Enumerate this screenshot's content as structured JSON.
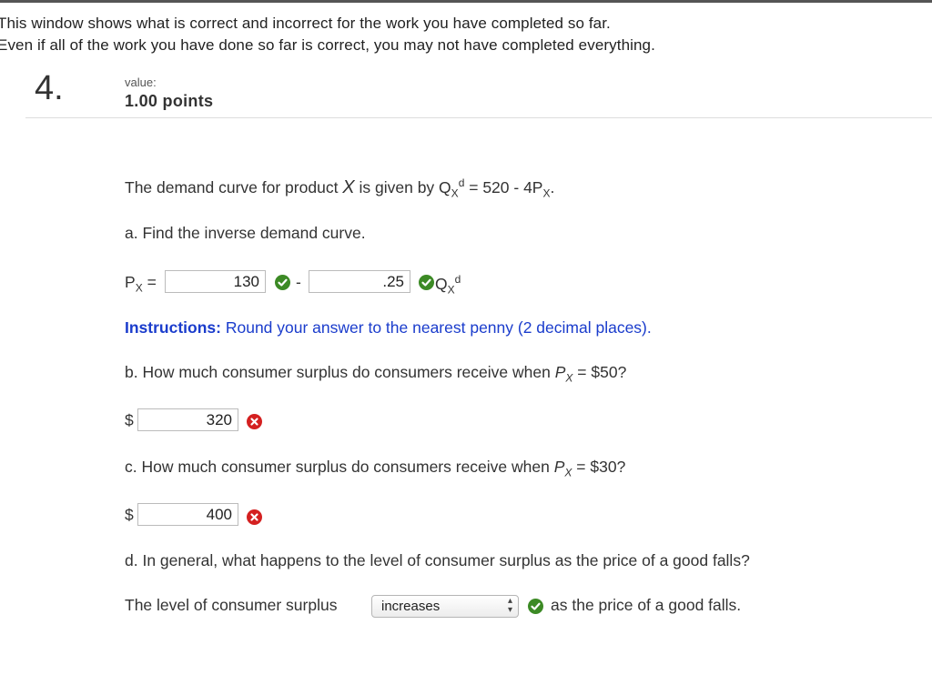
{
  "banner": {
    "line1": "This window shows what is correct and incorrect for the work you have completed so far.",
    "line2": "Even if all of the work you have done so far is correct, you may not have completed everything."
  },
  "question": {
    "number": "4.",
    "value_label": "value:",
    "points": "1.00 points"
  },
  "prompt": {
    "text_before": "The demand curve for product ",
    "var": "X",
    "text_mid": " is given by Q",
    "sub": "X",
    "sup": "d",
    "equation": " = 520 - 4P",
    "sub2": "X",
    "end": "."
  },
  "part_a": {
    "question": "a. Find the inverse demand curve.",
    "lhs": "P",
    "lhs_sub": "X",
    "lhs_eq": " =",
    "minus": "-",
    "intercept_value": "130",
    "slope_value": ".25",
    "rhs_q": "Q",
    "rhs_sub": "X",
    "rhs_sup": "d",
    "intercept_status": "correct",
    "slope_status": "correct"
  },
  "instructions": {
    "label": "Instructions:",
    "text": " Round your answer to the nearest penny (2 decimal places)."
  },
  "part_b": {
    "q_before": "b. How much consumer surplus do consumers receive when ",
    "p": "P",
    "sub": "X",
    "q_after": " = $50?",
    "currency": "$",
    "answer": "320",
    "status": "incorrect"
  },
  "part_c": {
    "q_before": "c. How much consumer surplus do consumers receive when ",
    "p": "P",
    "sub": "X",
    "q_after": " = $30?",
    "currency": "$",
    "answer": "400",
    "status": "incorrect"
  },
  "part_d": {
    "question": "d. In general, what happens to the level of consumer surplus as the price of a good falls?",
    "sentence_before": "The level of consumer surplus",
    "selected": "increases",
    "sentence_after": "as the price of a good falls.",
    "status": "correct"
  },
  "colors": {
    "correct": "#3c8a25",
    "incorrect": "#d42020",
    "instructions": "#1a3ccc"
  }
}
